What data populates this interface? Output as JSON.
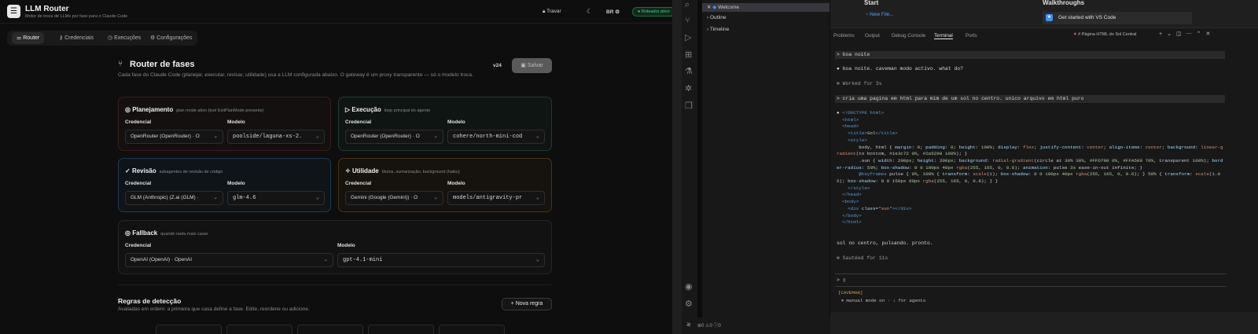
{
  "app": {
    "logo_glyph": "☰",
    "title": "LLM Router",
    "subtitle": "Motor de troca de LLMs por fase para o Claude Code",
    "lock": "Travar",
    "lang": "BR",
    "status": "Roteador ativo",
    "accent": "#3fd27a"
  },
  "nav": [
    {
      "label": "Router",
      "icon": "sliders-icon"
    },
    {
      "label": "Credenciais",
      "icon": "key-icon"
    },
    {
      "label": "Execuções",
      "icon": "clock-icon"
    },
    {
      "label": "Configurações",
      "icon": "gear-icon"
    }
  ],
  "header": {
    "title": "Router de fases",
    "desc": "Cada fase do Claude Code (planejar, executar, revisar, utilidade) usa a LLM configurada abaixo. O gateway é um proxy transparente — só o modelo troca.",
    "version": "v24",
    "save": "Salvar"
  },
  "labels": {
    "credencial": "Credencial",
    "modelo": "Modelo"
  },
  "phases": {
    "planejamento": {
      "title": "Planejamento",
      "sub": "plan mode ativo (tool ExitPlanMode presente)",
      "cred": "OpenRouter (OpenRouter) · O",
      "model": "poolside/laguna-xs-2."
    },
    "execucao": {
      "title": "Execução",
      "sub": "loop principal do agente",
      "cred": "OpenRouter (OpenRouter) · O",
      "model": "cohere/north-mini-cod"
    },
    "revisao": {
      "title": "Revisão",
      "sub": "subagentes de revisão de código",
      "cred": "GLM (Anthropic) (Z.ai (GLM) ·",
      "model": "glm-4.6"
    },
    "utilidade": {
      "title": "Utilidade",
      "sub": "títulos, sumarização, background (haiku)",
      "cred": "Gemini (Google (Gemini)) · O",
      "model": "models/antigravity-pr"
    },
    "fallback": {
      "title": "Fallback",
      "sub": "quando nada mais casar",
      "cred": "OpenAI (OpenAI) · OpenAI",
      "model": "gpt-4.1-mini"
    }
  },
  "rules": {
    "title": "Regras de detecção",
    "desc": "Avaliadas em ordem: a primeira que casa define a fase. Edite, reordene ou adicione.",
    "new": "+  Nova regra"
  },
  "vscode": {
    "explorer": [
      "Welcome",
      "Outline",
      "Timeline"
    ],
    "start": "Start",
    "new_file": "New File...",
    "walkthroughs": "Walkthroughs",
    "get_started": "Get started with VS Code",
    "panel_tabs": [
      "Problems",
      "Output",
      "Debug Console",
      "Terminal",
      "Ports"
    ],
    "terminal_title": "# Página HTML do Sol Central",
    "terminal": {
      "l1": "> boa noite",
      "l2": "● boa noite. caveman modo activo. what do?",
      "l3": "✻ Worked for 3s",
      "l4": "> cria uma pagina em html para mim de um sol no centro. unico arquivo em html puro",
      "l5": "sol no centro, pulsando. pronto.",
      "l6": "✻ Sautéed for 11s",
      "prompt": ">",
      "cave1": "[CAVEMAN]",
      "cave2": "⏸ manual mode on · ↓ for agents"
    }
  }
}
